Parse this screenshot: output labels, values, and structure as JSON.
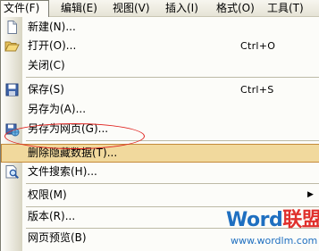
{
  "menubar": {
    "items": [
      {
        "label": "文件(F)"
      },
      {
        "label": "编辑(E)"
      },
      {
        "label": "视图(V)"
      },
      {
        "label": "插入(I)"
      },
      {
        "label": "格式(O)"
      },
      {
        "label": "工具(T)"
      }
    ]
  },
  "file_menu": {
    "new_doc": {
      "label": "新建(N)...",
      "icon": "new-document-icon"
    },
    "open": {
      "label": "打开(O)...",
      "shortcut": "Ctrl+O",
      "icon": "open-folder-icon"
    },
    "close": {
      "label": "关闭(C)"
    },
    "save": {
      "label": "保存(S)",
      "shortcut": "Ctrl+S",
      "icon": "floppy-disk-icon"
    },
    "save_as": {
      "label": "另存为(A)..."
    },
    "save_as_web": {
      "label": "另存为网页(G)...",
      "icon": "save-web-page-icon"
    },
    "remove_hidden": {
      "label": "删除隐藏数据(T)..."
    },
    "file_search": {
      "label": "文件搜索(H)...",
      "icon": "file-search-icon"
    },
    "permission": {
      "label": "权限(M)",
      "submenu_arrow": "▶"
    },
    "version": {
      "label": "版本(R)..."
    },
    "web_preview": {
      "label": "网页预览(B)"
    }
  },
  "highlight_color": "#f1d99d",
  "annotation_color": "#e0231f",
  "watermark": {
    "logo_word": "Word",
    "logo_cn": "联盟",
    "url": "www.wordlm.com"
  }
}
